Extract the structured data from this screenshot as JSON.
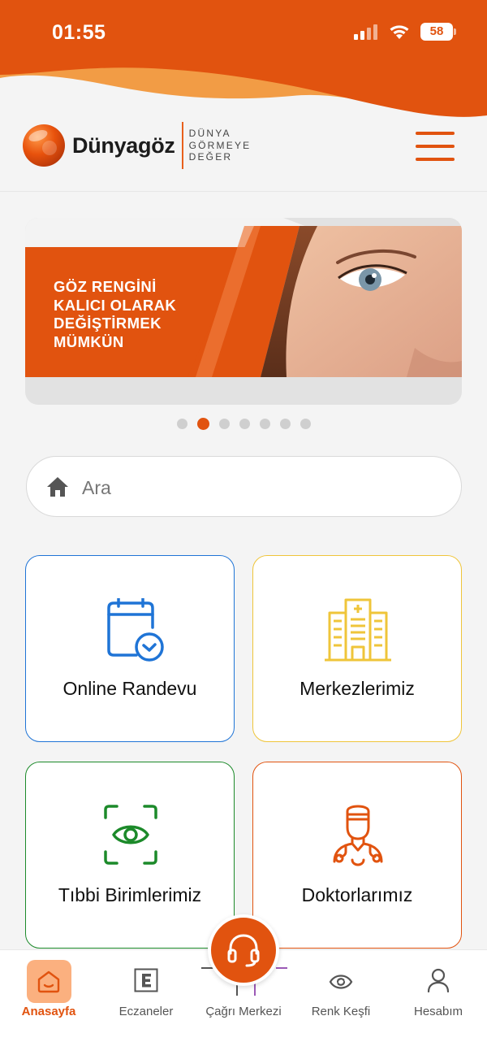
{
  "status_bar": {
    "time": "01:55",
    "battery": "58"
  },
  "brand": {
    "name": "Dünyagöz",
    "tagline": [
      "DÜNYA",
      "GÖRMEYE",
      "DEĞER"
    ]
  },
  "banner": {
    "lines": [
      "GÖZ RENGİNİ",
      "KALICI OLARAK",
      "DEĞİŞTİRMEK",
      "MÜMKÜN"
    ],
    "slide_count": 7,
    "active_slide": 2
  },
  "search": {
    "placeholder": "Ara"
  },
  "cards": [
    {
      "label": "Online Randevu",
      "icon": "calendar-check-icon",
      "color": "#1f74d6"
    },
    {
      "label": "Merkezlerimiz",
      "icon": "hospital-building-icon",
      "color": "#efc53a"
    },
    {
      "label": "Tıbbi Birimlerimiz",
      "icon": "eye-scan-icon",
      "color": "#1c8a2a"
    },
    {
      "label": "Doktorlarımız",
      "icon": "doctor-icon",
      "color": "#e1530f"
    }
  ],
  "bottom_nav": {
    "items": [
      {
        "label": "Anasayfa",
        "icon": "home-smile-icon",
        "active": true
      },
      {
        "label": "Eczaneler",
        "icon": "pharmacy-e-icon",
        "active": false
      },
      {
        "label": "Çağrı Merkezi",
        "icon": "headset-icon",
        "active": false
      },
      {
        "label": "Renk Keşfi",
        "icon": "color-eye-icon",
        "active": false
      },
      {
        "label": "Hesabım",
        "icon": "user-icon",
        "active": false
      }
    ]
  },
  "colors": {
    "brand_orange": "#e1530f",
    "light_orange": "#f4a24a",
    "pill_orange": "#fbb07f",
    "background": "#f4f4f4"
  }
}
